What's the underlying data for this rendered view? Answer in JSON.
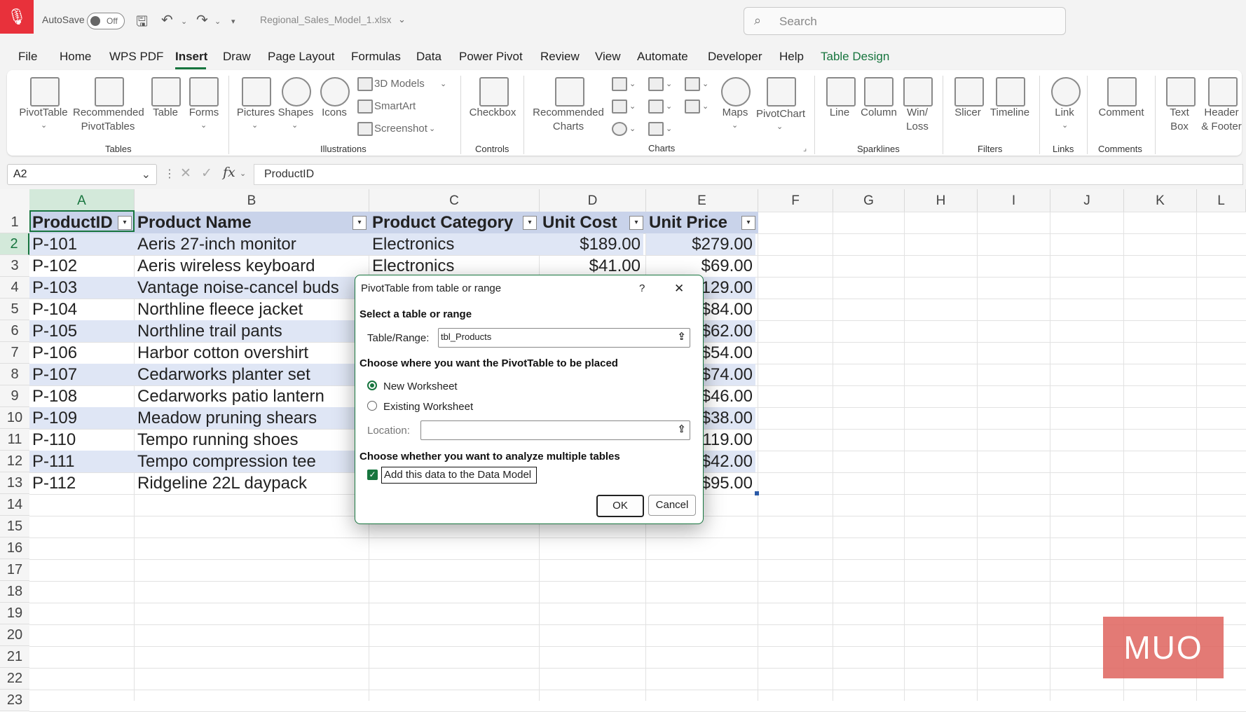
{
  "titlebar": {
    "autosave_label": "AutoSave",
    "autosave_state": "Off",
    "filename": "Regional_Sales_Model_1.xlsx",
    "search_placeholder": "Search"
  },
  "menu": [
    "File",
    "Home",
    "WPS PDF",
    "Insert",
    "Draw",
    "Page Layout",
    "Formulas",
    "Data",
    "Power Pivot",
    "Review",
    "View",
    "Automate",
    "Developer",
    "Help",
    "Table Design"
  ],
  "ribbon": {
    "tables": {
      "pivottable": "PivotTable",
      "recommended_line1": "Recommended",
      "recommended_line2": "PivotTables",
      "table": "Table",
      "forms": "Forms",
      "group": "Tables"
    },
    "illustrations": {
      "pictures": "Pictures",
      "shapes": "Shapes",
      "icons": "Icons",
      "models3d": "3D Models",
      "smartart": "SmartArt",
      "screenshot": "Screenshot",
      "group": "Illustrations"
    },
    "controls": {
      "checkbox": "Checkbox",
      "group": "Controls"
    },
    "charts": {
      "recommended_line1": "Recommended",
      "recommended_line2": "Charts",
      "maps": "Maps",
      "pivotchart": "PivotChart",
      "group": "Charts"
    },
    "sparklines": {
      "line": "Line",
      "column": "Column",
      "winloss_line1": "Win/",
      "winloss_line2": "Loss",
      "group": "Sparklines"
    },
    "filters": {
      "slicer": "Slicer",
      "timeline": "Timeline",
      "group": "Filters"
    },
    "links": {
      "link": "Link",
      "group": "Links"
    },
    "comments": {
      "comment": "Comment",
      "group": "Comments"
    },
    "text": {
      "textbox_line1": "Text",
      "textbox_line2": "Box",
      "header_line1": "Header",
      "header_line2": "& Footer"
    }
  },
  "formula_bar": {
    "name_box": "A2",
    "formula": "ProductID"
  },
  "columns": [
    "A",
    "B",
    "C",
    "D",
    "E",
    "F",
    "G",
    "H",
    "I",
    "J",
    "K",
    "L"
  ],
  "rows": [
    "1",
    "2",
    "3",
    "4",
    "5",
    "6",
    "7",
    "8",
    "9",
    "10",
    "11",
    "12",
    "13",
    "14",
    "15",
    "16",
    "17",
    "18",
    "19",
    "20",
    "21",
    "22",
    "23"
  ],
  "table": {
    "headers": [
      "ProductID",
      "Product Name",
      "Product Category",
      "Unit Cost",
      "Unit Price"
    ],
    "rows": [
      [
        "P-101",
        "Aeris 27-inch monitor",
        "Electronics",
        "$189.00",
        "$279.00"
      ],
      [
        "P-102",
        "Aeris wireless keyboard",
        "Electronics",
        "$41.00",
        "$69.00"
      ],
      [
        "P-103",
        "Vantage noise-cancel buds",
        "",
        "",
        "$129.00"
      ],
      [
        "P-104",
        "Northline fleece jacket",
        "",
        "",
        "$84.00"
      ],
      [
        "P-105",
        "Northline trail pants",
        "",
        "",
        "$62.00"
      ],
      [
        "P-106",
        "Harbor cotton overshirt",
        "",
        "",
        "$54.00"
      ],
      [
        "P-107",
        "Cedarworks planter set",
        "",
        "",
        "$74.00"
      ],
      [
        "P-108",
        "Cedarworks patio lantern",
        "",
        "",
        "$46.00"
      ],
      [
        "P-109",
        "Meadow pruning shears",
        "",
        "",
        "$38.00"
      ],
      [
        "P-110",
        "Tempo running shoes",
        "",
        "",
        "$119.00"
      ],
      [
        "P-111",
        "Tempo compression tee",
        "",
        "",
        "$42.00"
      ],
      [
        "P-112",
        "Ridgeline 22L daypack",
        "",
        "",
        "$95.00"
      ]
    ]
  },
  "dialog": {
    "title": "PivotTable from table or range",
    "help": "?",
    "close": "✕",
    "section1": "Select a table or range",
    "table_range_label": "Table/Range:",
    "table_range_value": "tbl_Products",
    "section2": "Choose where you want the PivotTable to be placed",
    "option_new": "New Worksheet",
    "option_existing": "Existing Worksheet",
    "location_label": "Location:",
    "location_value": "",
    "section3": "Choose whether you want to analyze multiple tables",
    "datamodel_label": "Add this data to the Data Model",
    "datamodel_checked": true,
    "ok": "OK",
    "cancel": "Cancel"
  },
  "watermark": "MUO",
  "colors": {
    "accent": "#17753e",
    "header_band": "#c9d3ea",
    "row_band": "#dfe6f5",
    "mic": "#e8313b"
  }
}
